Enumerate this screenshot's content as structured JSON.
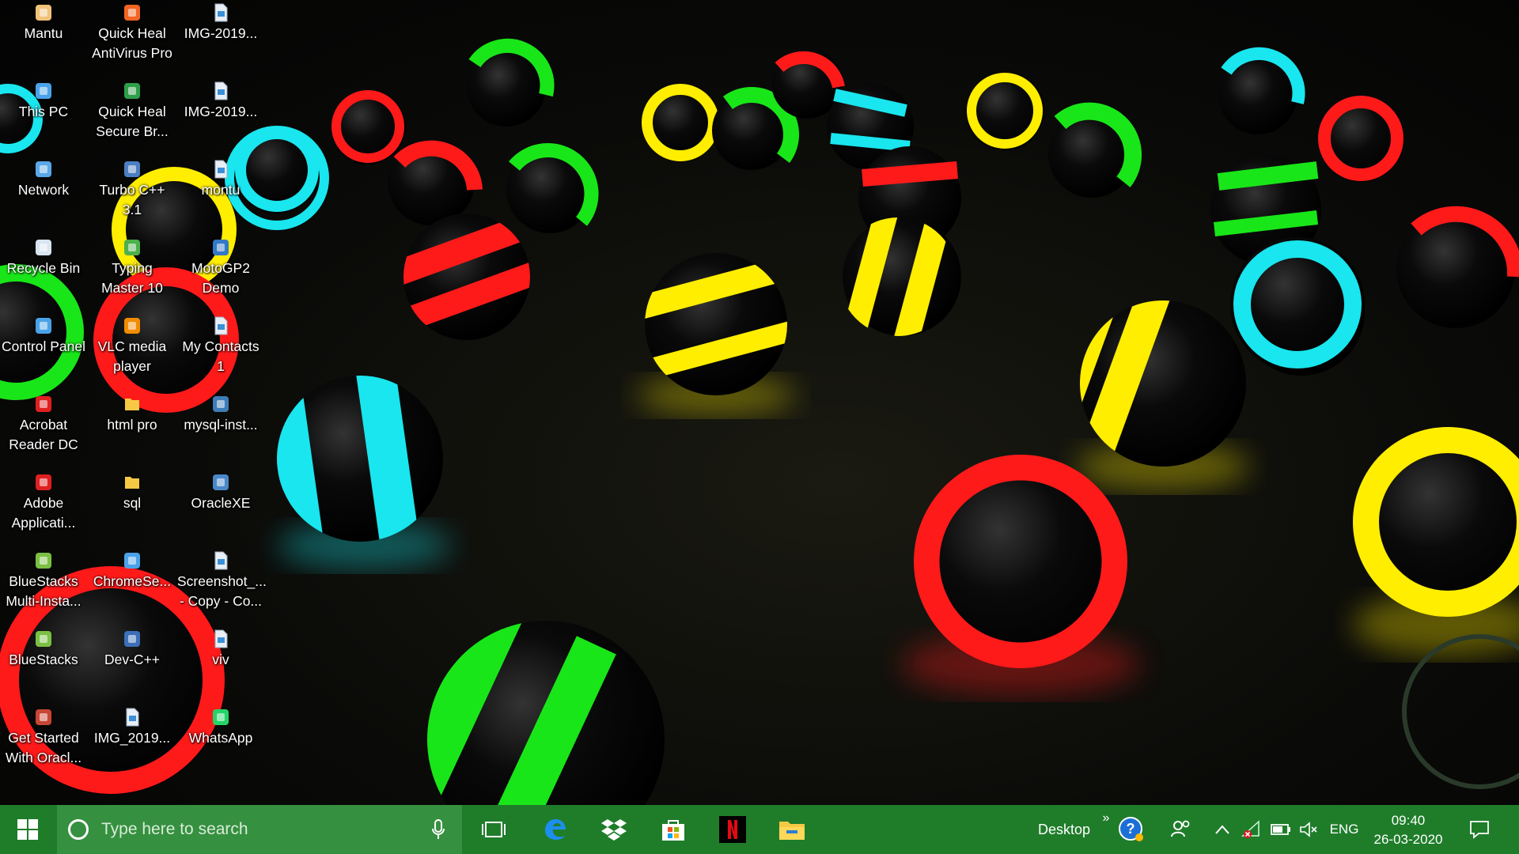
{
  "desktop": {
    "icons": [
      {
        "label": "Mantu",
        "icon": "user-folder-icon"
      },
      {
        "label": "This PC",
        "icon": "computer-icon"
      },
      {
        "label": "Network",
        "icon": "network-icon"
      },
      {
        "label": "Recycle Bin",
        "icon": "recycle-bin-icon"
      },
      {
        "label": "Control Panel",
        "icon": "control-panel-icon"
      },
      {
        "label": "Acrobat\nReader DC",
        "icon": "acrobat-icon"
      },
      {
        "label": "Adobe\nApplicati...",
        "icon": "adobe-icon"
      },
      {
        "label": "BlueStacks\nMulti-Insta...",
        "icon": "bluestacks-multi-icon"
      },
      {
        "label": "BlueStacks",
        "icon": "bluestacks-icon"
      },
      {
        "label": "Get Started\nWith Oracl...",
        "icon": "oracle-db-icon"
      },
      {
        "label": "Quick Heal\nAntiVirus Pro",
        "icon": "quickheal-icon"
      },
      {
        "label": "Quick Heal\nSecure Br...",
        "icon": "quickheal-browser-icon"
      },
      {
        "label": "Turbo C++\n3.1",
        "icon": "turbo-cpp-icon"
      },
      {
        "label": "Typing\nMaster 10",
        "icon": "typing-master-icon"
      },
      {
        "label": "VLC media\nplayer",
        "icon": "vlc-icon"
      },
      {
        "label": "html pro",
        "icon": "folder-icon"
      },
      {
        "label": "sql",
        "icon": "folder-icon"
      },
      {
        "label": "ChromeSe...",
        "icon": "chrome-setup-icon"
      },
      {
        "label": "Dev-C++",
        "icon": "devcpp-icon"
      },
      {
        "label": "IMG_2019...",
        "icon": "image-file-icon"
      },
      {
        "label": "IMG-2019...",
        "icon": "image-file-icon"
      },
      {
        "label": "IMG-2019...",
        "icon": "image-file-icon"
      },
      {
        "label": "montu",
        "icon": "image-file-icon"
      },
      {
        "label": "MotoGP2\nDemo",
        "icon": "motogp-icon"
      },
      {
        "label": "My Contacts\n1",
        "icon": "contacts-file-icon"
      },
      {
        "label": "mysql-inst...",
        "icon": "mysql-installer-icon"
      },
      {
        "label": "OracleXE",
        "icon": "oracle-xe-icon"
      },
      {
        "label": "Screenshot_...\n- Copy - Co...",
        "icon": "image-file-icon"
      },
      {
        "label": "viv",
        "icon": "image-file-icon"
      },
      {
        "label": "WhatsApp",
        "icon": "whatsapp-icon"
      }
    ]
  },
  "taskbar": {
    "search_placeholder": "Type here to search",
    "pinned": [
      {
        "name": "task-view",
        "icon": "task-view-icon"
      },
      {
        "name": "edge",
        "icon": "edge-icon"
      },
      {
        "name": "dropbox",
        "icon": "dropbox-icon"
      },
      {
        "name": "store",
        "icon": "store-icon"
      },
      {
        "name": "netflix",
        "icon": "netflix-icon"
      },
      {
        "name": "file-explorer",
        "icon": "file-explorer-icon"
      }
    ],
    "desktop_toolbar_label": "Desktop",
    "language": "ENG",
    "time": "09:40",
    "date": "26-03-2020"
  },
  "colors": {
    "taskbar": "#1f7d2a",
    "search_box": "#35903f",
    "neon_red": "#ff1a1a",
    "neon_yellow": "#ffee00",
    "neon_green": "#19e619",
    "neon_cyan": "#19e6ee"
  }
}
